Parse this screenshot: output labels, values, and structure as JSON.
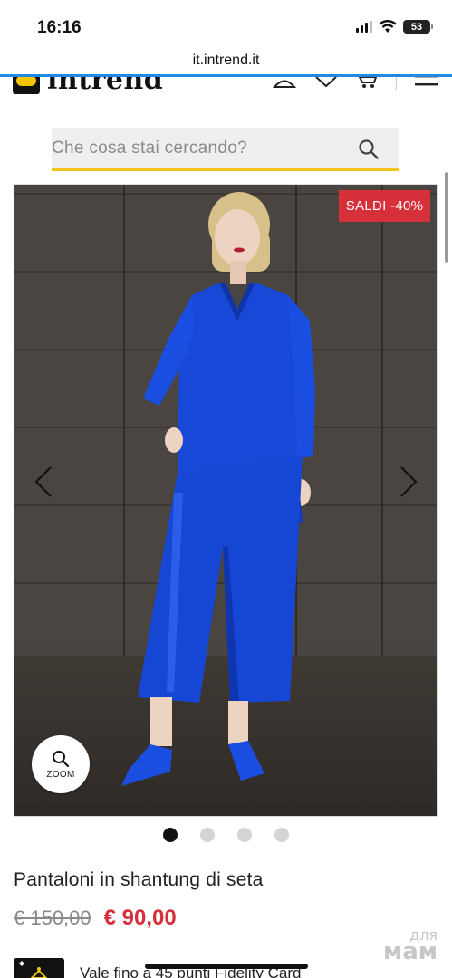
{
  "status_bar": {
    "time": "16:16",
    "battery": "53",
    "icons": [
      "signal-icon",
      "wifi-icon",
      "battery-icon"
    ]
  },
  "browser": {
    "url": "it.intrend.it"
  },
  "header": {
    "logo_text": "intrend",
    "icons": [
      "account-icon",
      "wishlist-heart-icon",
      "cart-icon",
      "menu-icon"
    ]
  },
  "search": {
    "placeholder": "Che cosa stai cercando?",
    "accent_color": "#f0c419"
  },
  "gallery": {
    "sale_badge": "SALDI  -40%",
    "zoom_label": "ZOOM",
    "slide_count": 4,
    "active_slide": 1,
    "badge_color": "#d6303a"
  },
  "product": {
    "title": "Pantaloni in shantung di seta",
    "old_price": "€ 150,00",
    "new_price": "€ 90,00"
  },
  "fidelity": {
    "text": "Vale fino a 45 punti Fidelity Card"
  },
  "watermark": {
    "line1": "для",
    "line2": "мам"
  }
}
